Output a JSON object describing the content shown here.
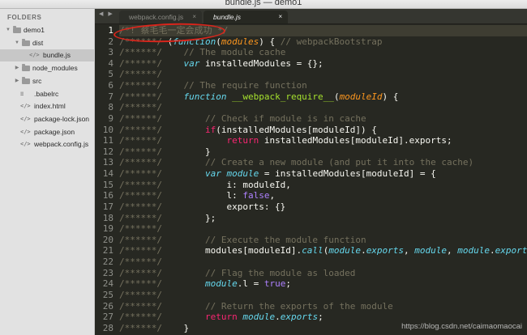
{
  "window": {
    "title": "bundle.js — demo1"
  },
  "sidebar": {
    "header": "FOLDERS",
    "items": [
      {
        "label": "demo1",
        "kind": "folder",
        "depth": 0,
        "expanded": true,
        "icon": "folder-icon"
      },
      {
        "label": "dist",
        "kind": "folder",
        "depth": 1,
        "expanded": true,
        "icon": "folder-icon"
      },
      {
        "label": "bundle.js",
        "kind": "file",
        "depth": 2,
        "selected": true,
        "icon": "js-file-icon"
      },
      {
        "label": "node_modules",
        "kind": "folder",
        "depth": 1,
        "expanded": false,
        "icon": "folder-icon"
      },
      {
        "label": "src",
        "kind": "folder",
        "depth": 1,
        "expanded": false,
        "icon": "folder-icon"
      },
      {
        "label": ".babelrc",
        "kind": "file",
        "depth": 1,
        "icon": "file-icon"
      },
      {
        "label": "index.html",
        "kind": "file",
        "depth": 1,
        "icon": "html-file-icon"
      },
      {
        "label": "package-lock.json",
        "kind": "file",
        "depth": 1,
        "icon": "json-file-icon"
      },
      {
        "label": "package.json",
        "kind": "file",
        "depth": 1,
        "icon": "json-file-icon"
      },
      {
        "label": "webpack.config.js",
        "kind": "file",
        "depth": 1,
        "icon": "js-file-icon"
      }
    ]
  },
  "tabs": [
    {
      "label": "webpack.config.js",
      "close": "×",
      "active": false
    },
    {
      "label": "bundle.js",
      "close": "×",
      "active": true
    }
  ],
  "tab_nav": "◀ ▶",
  "editor": {
    "active_line": 1,
    "lines": [
      {
        "n": "1",
        "tokens": [
          {
            "t": "/*! 蔡毛毛一定会成功 */",
            "c": "com"
          }
        ]
      },
      {
        "n": "2",
        "tokens": [
          {
            "t": "/******/ ",
            "c": "com"
          },
          {
            "t": "(",
            "c": "txt"
          },
          {
            "t": "function",
            "c": "st"
          },
          {
            "t": "(",
            "c": "txt"
          },
          {
            "t": "modules",
            "c": "prm"
          },
          {
            "t": ") { ",
            "c": "txt"
          },
          {
            "t": "// webpackBootstrap",
            "c": "com"
          }
        ]
      },
      {
        "n": "3",
        "tokens": [
          {
            "t": "/******/ ",
            "c": "com"
          },
          {
            "t": "   ",
            "c": "txt"
          },
          {
            "t": "// The module cache",
            "c": "com"
          }
        ]
      },
      {
        "n": "4",
        "tokens": [
          {
            "t": "/******/ ",
            "c": "com"
          },
          {
            "t": "   ",
            "c": "txt"
          },
          {
            "t": "var",
            "c": "st"
          },
          {
            "t": " installedModules = {};",
            "c": "txt"
          }
        ]
      },
      {
        "n": "5",
        "tokens": [
          {
            "t": "/******/",
            "c": "com"
          }
        ]
      },
      {
        "n": "6",
        "tokens": [
          {
            "t": "/******/ ",
            "c": "com"
          },
          {
            "t": "   ",
            "c": "txt"
          },
          {
            "t": "// The require function",
            "c": "com"
          }
        ]
      },
      {
        "n": "7",
        "tokens": [
          {
            "t": "/******/ ",
            "c": "com"
          },
          {
            "t": "   ",
            "c": "txt"
          },
          {
            "t": "function",
            "c": "st"
          },
          {
            "t": " ",
            "c": "txt"
          },
          {
            "t": "__webpack_require__",
            "c": "fn"
          },
          {
            "t": "(",
            "c": "txt"
          },
          {
            "t": "moduleId",
            "c": "prm"
          },
          {
            "t": ") {",
            "c": "txt"
          }
        ]
      },
      {
        "n": "8",
        "tokens": [
          {
            "t": "/******/",
            "c": "com"
          }
        ]
      },
      {
        "n": "9",
        "tokens": [
          {
            "t": "/******/ ",
            "c": "com"
          },
          {
            "t": "       ",
            "c": "txt"
          },
          {
            "t": "// Check if module is in cache",
            "c": "com"
          }
        ]
      },
      {
        "n": "10",
        "tokens": [
          {
            "t": "/******/ ",
            "c": "com"
          },
          {
            "t": "       ",
            "c": "txt"
          },
          {
            "t": "if",
            "c": "kw"
          },
          {
            "t": "(installedModules[moduleId]) {",
            "c": "txt"
          }
        ]
      },
      {
        "n": "11",
        "tokens": [
          {
            "t": "/******/ ",
            "c": "com"
          },
          {
            "t": "           ",
            "c": "txt"
          },
          {
            "t": "return",
            "c": "kw"
          },
          {
            "t": " installedModules[moduleId].exports;",
            "c": "txt"
          }
        ]
      },
      {
        "n": "12",
        "tokens": [
          {
            "t": "/******/ ",
            "c": "com"
          },
          {
            "t": "       }",
            "c": "txt"
          }
        ]
      },
      {
        "n": "13",
        "tokens": [
          {
            "t": "/******/ ",
            "c": "com"
          },
          {
            "t": "       ",
            "c": "txt"
          },
          {
            "t": "// Create a new module (and put it into the cache)",
            "c": "com"
          }
        ]
      },
      {
        "n": "14",
        "tokens": [
          {
            "t": "/******/ ",
            "c": "com"
          },
          {
            "t": "       ",
            "c": "txt"
          },
          {
            "t": "var",
            "c": "st"
          },
          {
            "t": " ",
            "c": "txt"
          },
          {
            "t": "module",
            "c": "st"
          },
          {
            "t": " = installedModules[moduleId] = {",
            "c": "txt"
          }
        ]
      },
      {
        "n": "15",
        "tokens": [
          {
            "t": "/******/ ",
            "c": "com"
          },
          {
            "t": "           i: moduleId,",
            "c": "txt"
          }
        ]
      },
      {
        "n": "16",
        "tokens": [
          {
            "t": "/******/ ",
            "c": "com"
          },
          {
            "t": "           l: ",
            "c": "txt"
          },
          {
            "t": "false",
            "c": "con"
          },
          {
            "t": ",",
            "c": "txt"
          }
        ]
      },
      {
        "n": "17",
        "tokens": [
          {
            "t": "/******/ ",
            "c": "com"
          },
          {
            "t": "           exports: {}",
            "c": "txt"
          }
        ]
      },
      {
        "n": "18",
        "tokens": [
          {
            "t": "/******/ ",
            "c": "com"
          },
          {
            "t": "       };",
            "c": "txt"
          }
        ]
      },
      {
        "n": "19",
        "tokens": [
          {
            "t": "/******/",
            "c": "com"
          }
        ]
      },
      {
        "n": "20",
        "tokens": [
          {
            "t": "/******/ ",
            "c": "com"
          },
          {
            "t": "       ",
            "c": "txt"
          },
          {
            "t": "// Execute the module function",
            "c": "com"
          }
        ]
      },
      {
        "n": "21",
        "tokens": [
          {
            "t": "/******/ ",
            "c": "com"
          },
          {
            "t": "       modules[moduleId].",
            "c": "txt"
          },
          {
            "t": "call",
            "c": "st"
          },
          {
            "t": "(",
            "c": "txt"
          },
          {
            "t": "module",
            "c": "st"
          },
          {
            "t": ".",
            "c": "txt"
          },
          {
            "t": "exports",
            "c": "st"
          },
          {
            "t": ", ",
            "c": "txt"
          },
          {
            "t": "module",
            "c": "st"
          },
          {
            "t": ", ",
            "c": "txt"
          },
          {
            "t": "module",
            "c": "st"
          },
          {
            "t": ".",
            "c": "txt"
          },
          {
            "t": "exports",
            "c": "st"
          }
        ]
      },
      {
        "n": "22",
        "tokens": [
          {
            "t": "/******/",
            "c": "com"
          }
        ]
      },
      {
        "n": "23",
        "tokens": [
          {
            "t": "/******/ ",
            "c": "com"
          },
          {
            "t": "       ",
            "c": "txt"
          },
          {
            "t": "// Flag the module as loaded",
            "c": "com"
          }
        ]
      },
      {
        "n": "24",
        "tokens": [
          {
            "t": "/******/ ",
            "c": "com"
          },
          {
            "t": "       ",
            "c": "txt"
          },
          {
            "t": "module",
            "c": "st"
          },
          {
            "t": ".l = ",
            "c": "txt"
          },
          {
            "t": "true",
            "c": "con"
          },
          {
            "t": ";",
            "c": "txt"
          }
        ]
      },
      {
        "n": "25",
        "tokens": [
          {
            "t": "/******/",
            "c": "com"
          }
        ]
      },
      {
        "n": "26",
        "tokens": [
          {
            "t": "/******/ ",
            "c": "com"
          },
          {
            "t": "       ",
            "c": "txt"
          },
          {
            "t": "// Return the exports of the module",
            "c": "com"
          }
        ]
      },
      {
        "n": "27",
        "tokens": [
          {
            "t": "/******/ ",
            "c": "com"
          },
          {
            "t": "       ",
            "c": "txt"
          },
          {
            "t": "return",
            "c": "kw"
          },
          {
            "t": " ",
            "c": "txt"
          },
          {
            "t": "module",
            "c": "st"
          },
          {
            "t": ".",
            "c": "txt"
          },
          {
            "t": "exports",
            "c": "st"
          },
          {
            "t": ";",
            "c": "txt"
          }
        ]
      },
      {
        "n": "28",
        "tokens": [
          {
            "t": "/******/ ",
            "c": "com"
          },
          {
            "t": "   }",
            "c": "txt"
          }
        ]
      }
    ]
  },
  "watermark": "https://blog.csdn.net/caimaomaocai",
  "colors": {
    "editor_bg": "#272822",
    "comment": "#75715e",
    "keyword": "#f92672",
    "storage": "#66d9ef",
    "function": "#a6e22e",
    "param": "#fd971f",
    "constant": "#ae81ff",
    "annotation": "#d9261c"
  }
}
